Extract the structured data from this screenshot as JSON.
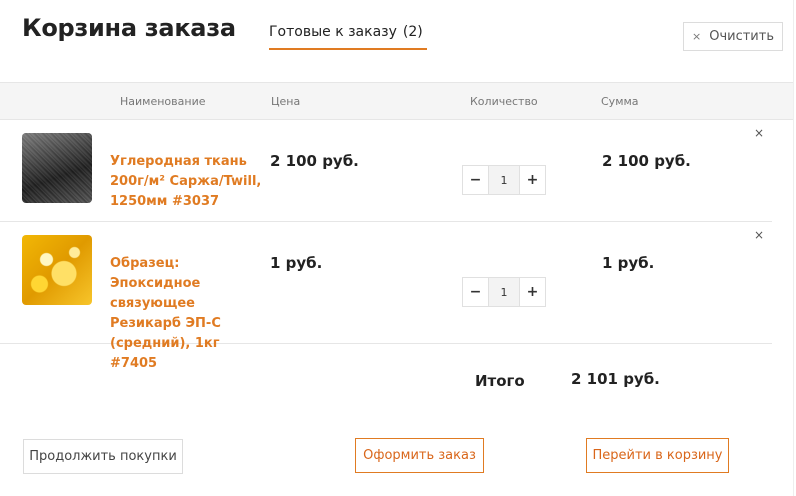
{
  "header": {
    "title": "Корзина заказа",
    "tab_label": "Готовые к заказу",
    "tab_count": "(2)",
    "clear_icon": "×",
    "clear_label": "Очистить"
  },
  "columns": {
    "name": "Наименование",
    "price": "Цена",
    "quantity": "Количество",
    "sum": "Сумма"
  },
  "items": [
    {
      "name": "Углеродная ткань 200г/м² Саржа/Twill, 1250мм #3037",
      "price": "2 100 руб.",
      "quantity": "1",
      "sum": "2 100 руб."
    },
    {
      "name": "Образец: Эпоксидное связующее Резикарб ЭП-С (средний), 1кг #7405",
      "price": "1 руб.",
      "quantity": "1",
      "sum": "1 руб."
    }
  ],
  "controls": {
    "minus": "−",
    "plus": "+",
    "remove": "×"
  },
  "total": {
    "label": "Итого",
    "value": "2 101 руб."
  },
  "buttons": {
    "continue": "Продолжить покупки",
    "checkout": "Оформить заказ",
    "go_to_cart": "Перейти в корзину"
  },
  "colors": {
    "accent": "#e07b22",
    "header_bg": "#f5f5f5"
  }
}
